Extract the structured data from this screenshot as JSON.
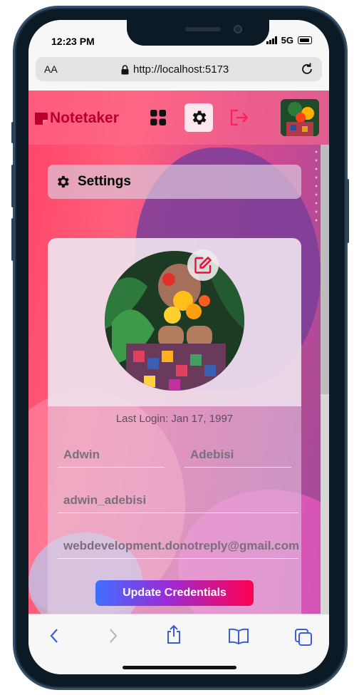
{
  "status_bar": {
    "time": "12:23 PM",
    "network": "5G"
  },
  "browser": {
    "text_size_label": "AA",
    "url": "http://localhost:5173"
  },
  "navbar": {
    "logo_text": "Notetaker",
    "icons": [
      "grid-icon",
      "gear-icon",
      "logout-icon"
    ],
    "active_icon": "gear-icon",
    "brand_color": "#b8002a"
  },
  "settings": {
    "title": "Settings"
  },
  "profile": {
    "last_login": "Last Login: Jan 17, 1997",
    "first_name": "Adwin",
    "last_name": "Adebisi",
    "username": "adwin_adebisi",
    "email": "webdevelopment.donotreply@gmail.com",
    "update_button": "Update Credentials"
  },
  "safari_toolbar": {
    "icons": [
      "back-icon",
      "forward-icon",
      "share-icon",
      "bookmarks-icon",
      "tabs-icon"
    ]
  }
}
